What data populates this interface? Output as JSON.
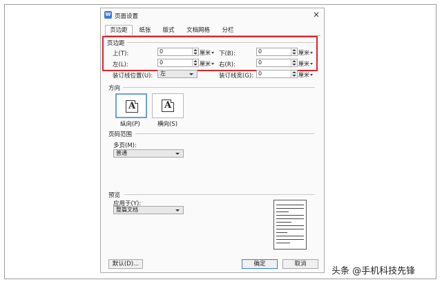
{
  "dialog": {
    "title": "页面设置",
    "close_glyph": "×"
  },
  "tabs": [
    "页边距",
    "纸张",
    "版式",
    "文档网格",
    "分栏"
  ],
  "margins": {
    "section_label": "页边距",
    "top": {
      "label": "上(T):",
      "value": "0",
      "unit": "厘米"
    },
    "bottom": {
      "label": "下(B):",
      "value": "0",
      "unit": "厘米"
    },
    "left": {
      "label": "左(L):",
      "value": "0",
      "unit": "厘米"
    },
    "right": {
      "label": "右(R):",
      "value": "0",
      "unit": "厘米"
    },
    "gutter_pos": {
      "label": "装订线位置(U):",
      "value": "左"
    },
    "gutter_width": {
      "label": "装订线宽(G):",
      "value": "0",
      "unit": "厘米"
    }
  },
  "orientation": {
    "section_label": "方向",
    "icon_letter": "A",
    "portrait_label": "纵向(P)",
    "landscape_label": "横向(S)"
  },
  "page_range": {
    "section_label": "页码范围",
    "multi_label": "多页(M):",
    "multi_value": "普通"
  },
  "preview": {
    "section_label": "预览",
    "apply_label": "应用于(Y):",
    "apply_value": "整篇文档"
  },
  "buttons": {
    "default": "默认(D)...",
    "ok": "确定",
    "cancel": "取消"
  },
  "watermark": "头条 @手机科技先锋",
  "colors": {
    "highlight_box": "#d9252a",
    "app_icon": "#3b7cd8"
  }
}
